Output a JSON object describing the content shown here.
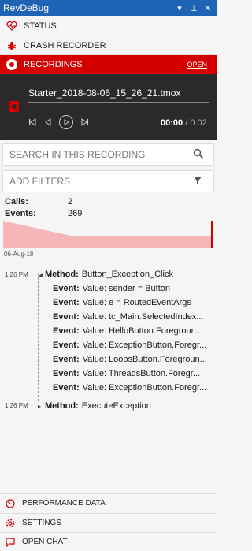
{
  "window": {
    "title": "RevDeBug",
    "menu_glyph": "▾",
    "pin_glyph": "⊥",
    "close_glyph": "✕"
  },
  "nav": {
    "status": "STATUS",
    "crash": "CRASH RECORDER",
    "recordings": "RECORDINGS",
    "open": "OPEN"
  },
  "player": {
    "filename": "Starter_2018-08-06_15_26_21.tmox",
    "current": "00:00",
    "duration": "/ 0:02"
  },
  "search": {
    "placeholder": "SEARCH IN THIS RECORDING"
  },
  "filters": {
    "label": "ADD FILTERS"
  },
  "stats": {
    "calls_label": "Calls:",
    "calls_value": "2",
    "events_label": "Events:",
    "events_value": "269"
  },
  "timeline": {
    "date": "06-Aug-18"
  },
  "log": [
    {
      "time": "1:26 PM",
      "kind": "Method:",
      "name": "Button_Exception_Click",
      "events": [
        {
          "kind": "Event:",
          "text": "Value: sender = Button"
        },
        {
          "kind": "Event:",
          "text": "Value: e = RoutedEventArgs"
        },
        {
          "kind": "Event:",
          "text": "Value: tc_Main.SelectedIndex..."
        },
        {
          "kind": "Event:",
          "text": "Value: HelloButton.Foregroun..."
        },
        {
          "kind": "Event:",
          "text": "Value: ExceptionButton.Foregr..."
        },
        {
          "kind": "Event:",
          "text": "Value: LoopsButton.Foregroun..."
        },
        {
          "kind": "Event:",
          "text": "Value: ThreadsButton.Foregr..."
        },
        {
          "kind": "Event:",
          "text": "Value: ExceptionButton.Foregr..."
        }
      ]
    },
    {
      "time": "1:26 PM",
      "kind": "Method:",
      "name": "ExecuteException",
      "events": []
    }
  ],
  "bottom": {
    "performance": "PERFORMANCE DATA",
    "settings": "SETTINGS",
    "chat": "OPEN CHAT"
  },
  "colors": {
    "accent": "#d40000",
    "titlebar": "#1f63b5",
    "player_bg": "#2a2a2a",
    "timeline_fill": "#f4b6b6"
  }
}
